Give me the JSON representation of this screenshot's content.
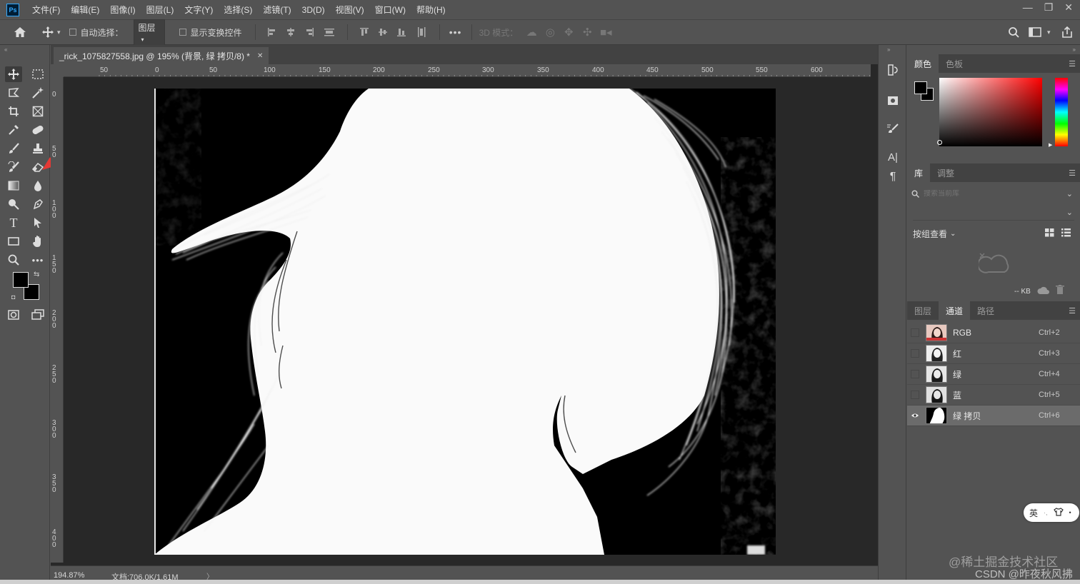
{
  "app": {
    "logo": "Ps"
  },
  "menu": [
    "文件(F)",
    "编辑(E)",
    "图像(I)",
    "图层(L)",
    "文字(Y)",
    "选择(S)",
    "滤镜(T)",
    "3D(D)",
    "视图(V)",
    "窗口(W)",
    "帮助(H)"
  ],
  "window_controls": {
    "minimize": "—",
    "restore": "❐",
    "close": "✕"
  },
  "options": {
    "auto_select_label": "自动选择：",
    "auto_select_target": "图层",
    "show_transform_label": "显示变换控件",
    "mode_3d_label": "3D 模式："
  },
  "document": {
    "tab_title": "_rick_1075827558.jpg @ 195% (背景, 绿 拷贝/8) *",
    "close_icon": "✕"
  },
  "ruler_h": [
    "50",
    "0",
    "50",
    "100",
    "150",
    "200",
    "250",
    "300",
    "350",
    "400",
    "450",
    "500",
    "550",
    "600"
  ],
  "ruler_v": [
    "0",
    "5 0",
    "1 0 0",
    "1 5 0",
    "2 0 0",
    "2 5 0",
    "3 0 0",
    "3 5 0",
    "4 0 0"
  ],
  "status": {
    "zoom": "194.87%",
    "doc_size": "文档:706.0K/1.61M",
    "arrow": "〉"
  },
  "color_panel": {
    "tabs": [
      "颜色",
      "色板"
    ]
  },
  "library_panel": {
    "tabs": [
      "库",
      "调整"
    ],
    "search_placeholder": "搜索当前库",
    "view_by": "按组查看",
    "size": "-- KB"
  },
  "channels_panel": {
    "tabs": [
      "图层",
      "通道",
      "路径"
    ],
    "rows": [
      {
        "name": "RGB",
        "shortcut": "Ctrl+2",
        "visible": false
      },
      {
        "name": "红",
        "shortcut": "Ctrl+3",
        "visible": false
      },
      {
        "name": "绿",
        "shortcut": "Ctrl+4",
        "visible": false
      },
      {
        "name": "蓝",
        "shortcut": "Ctrl+5",
        "visible": false
      },
      {
        "name": "绿 拷贝",
        "shortcut": "Ctrl+6",
        "visible": true
      }
    ]
  },
  "ime": {
    "label": "英"
  },
  "watermark": {
    "line1": "@稀土掘金技术社区",
    "line2": "CSDN @昨夜秋风拂"
  },
  "colors": {
    "accent": "#31a8ff",
    "panel_bg": "#535353",
    "canvas_bg": "#282828"
  }
}
